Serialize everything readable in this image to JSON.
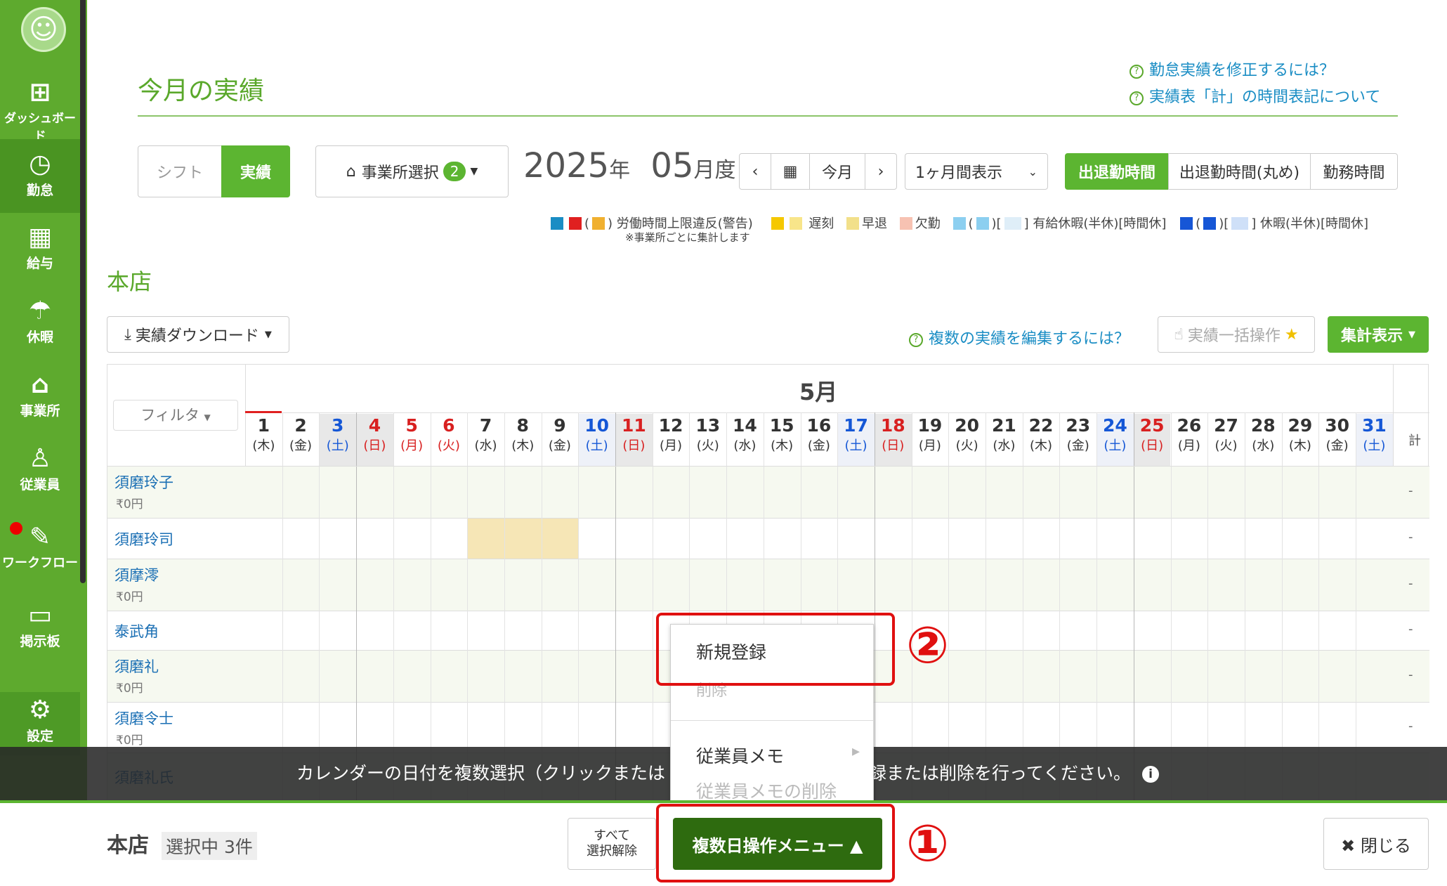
{
  "sidebar": {
    "items": [
      {
        "label": "ダッシュボード",
        "icon": "dashboard-icon"
      },
      {
        "label": "勤怠",
        "icon": "clock-icon"
      },
      {
        "label": "給与",
        "icon": "calculator-icon"
      },
      {
        "label": "休暇",
        "icon": "umbrella-icon"
      },
      {
        "label": "事業所",
        "icon": "home-icon"
      },
      {
        "label": "従業員",
        "icon": "person-icon"
      },
      {
        "label": "ワークフロー",
        "icon": "workflow-icon"
      },
      {
        "label": "掲示板",
        "icon": "chat-icon"
      },
      {
        "label": "設定",
        "icon": "gear-icon"
      }
    ]
  },
  "header": {
    "title": "今月の実績",
    "help1": "勤怠実績を修正するには？",
    "help2": "実績表「計」の時間表記について"
  },
  "toolbar": {
    "shift": "シフト",
    "actual": "実績",
    "office_select": "事業所選択",
    "office_count": "2",
    "year": "2025",
    "year_unit": "年",
    "month": "05",
    "month_unit": "月度",
    "prev": "‹",
    "next": "›",
    "today": "今月",
    "period": "1ヶ月間表示",
    "view1": "出退勤時間",
    "view2": "出退勤時間(丸め)",
    "view3": "勤務時間"
  },
  "legend": {
    "overtime": "労働時間上限違反(警告)",
    "note": "※事業所ごとに集計します",
    "late": "遅刻",
    "early": "早退",
    "absent": "欠勤",
    "paid": "有給休暇(半休)[時間休]",
    "holiday": "休暇(半休)[時間休]"
  },
  "store": "本店",
  "actions": {
    "download": "実績ダウンロード",
    "help_multi": "複数の実績を編集するには？",
    "bulk": "実績一括操作",
    "summary": "集計表示"
  },
  "calendar": {
    "month": "5月",
    "filter": "フィルタ",
    "total_header": "計",
    "days": [
      {
        "n": "1",
        "w": "(木)"
      },
      {
        "n": "2",
        "w": "(金)"
      },
      {
        "n": "3",
        "w": "(土)"
      },
      {
        "n": "4",
        "w": "(日)"
      },
      {
        "n": "5",
        "w": "(月)"
      },
      {
        "n": "6",
        "w": "(火)"
      },
      {
        "n": "7",
        "w": "(水)"
      },
      {
        "n": "8",
        "w": "(木)"
      },
      {
        "n": "9",
        "w": "(金)"
      },
      {
        "n": "10",
        "w": "(土)"
      },
      {
        "n": "11",
        "w": "(日)"
      },
      {
        "n": "12",
        "w": "(月)"
      },
      {
        "n": "13",
        "w": "(火)"
      },
      {
        "n": "14",
        "w": "(水)"
      },
      {
        "n": "15",
        "w": "(木)"
      },
      {
        "n": "16",
        "w": "(金)"
      },
      {
        "n": "17",
        "w": "(土)"
      },
      {
        "n": "18",
        "w": "(日)"
      },
      {
        "n": "19",
        "w": "(月)"
      },
      {
        "n": "20",
        "w": "(火)"
      },
      {
        "n": "21",
        "w": "(水)"
      },
      {
        "n": "22",
        "w": "(木)"
      },
      {
        "n": "23",
        "w": "(金)"
      },
      {
        "n": "24",
        "w": "(土)"
      },
      {
        "n": "25",
        "w": "(日)"
      },
      {
        "n": "26",
        "w": "(月)"
      },
      {
        "n": "27",
        "w": "(火)"
      },
      {
        "n": "28",
        "w": "(水)"
      },
      {
        "n": "29",
        "w": "(木)"
      },
      {
        "n": "30",
        "w": "(金)"
      },
      {
        "n": "31",
        "w": "(土)"
      }
    ],
    "employees": [
      {
        "name": "須磨玲子",
        "wage": "₹0円"
      },
      {
        "name": "須磨玲司",
        "wage": ""
      },
      {
        "name": "須摩澪",
        "wage": "₹0円"
      },
      {
        "name": "泰武角",
        "wage": ""
      },
      {
        "name": "須磨礼",
        "wage": "₹0円"
      },
      {
        "name": "須磨令士",
        "wage": "₹0円"
      },
      {
        "name": "須磨礼氏",
        "wage": ""
      }
    ],
    "dash": "-"
  },
  "banner": {
    "text": "カレンダーの日付を複数選択（クリックまたは",
    "text2": "録または削除を行ってください。"
  },
  "menu": {
    "new": "新規登録",
    "delete": "削除",
    "memo": "従業員メモ",
    "memo_delete": "従業員メモの削除"
  },
  "annotations": {
    "one": "①",
    "two": "②"
  },
  "bottom": {
    "store": "本店",
    "selected": "選択中 3件",
    "clear_all_1": "すべて",
    "clear_all_2": "選択解除",
    "multi_menu": "複数日操作メニュー ▲",
    "close": "✖ 閉じる"
  },
  "colors": {
    "brand_green": "#5cb531",
    "sidebar_green": "#5eaa2e",
    "dark_green_button": "#2e6b0f",
    "saturday": "#1557d6",
    "sunday": "#d82020",
    "annotation_red": "#e01010"
  }
}
